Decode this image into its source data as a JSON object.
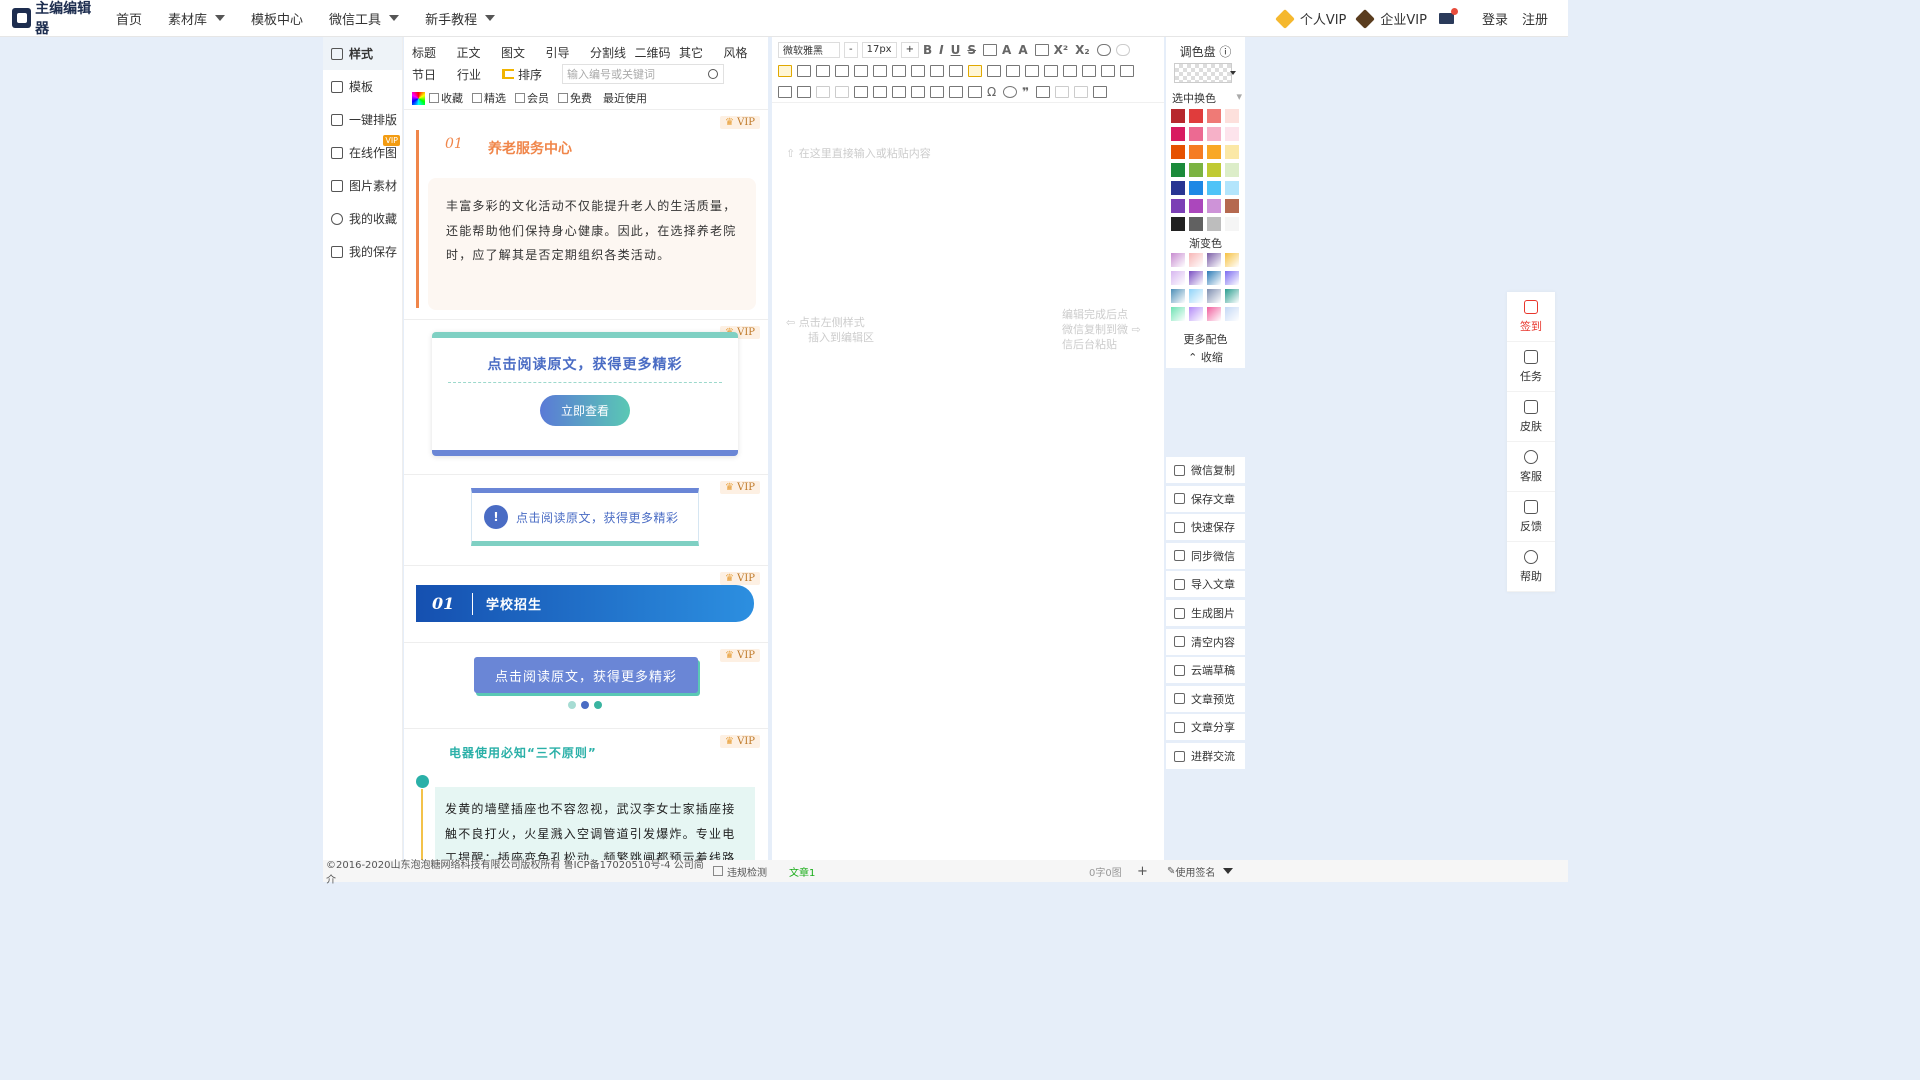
{
  "brand": {
    "name": "主编编辑器"
  },
  "nav": {
    "home": "首页",
    "materials": "素材库",
    "templates": "模板中心",
    "wechat_tools": "微信工具",
    "tutorial": "新手教程"
  },
  "top": {
    "personal_vip": "个人VIP",
    "enterprise_vip": "企业VIP",
    "login": "登录",
    "register": "注册"
  },
  "leftnav": [
    "样式",
    "模板",
    "一键排版",
    "在线作图",
    "图片素材",
    "我的收藏",
    "我的保存"
  ],
  "leftnav_vip": "VIP",
  "tabs": {
    "row1": [
      "标题",
      "正文",
      "图文",
      "引导",
      "分割线",
      "二维码",
      "其它",
      "风格"
    ],
    "row2": [
      "节日",
      "行业"
    ],
    "sort": "排序",
    "search_placeholder": "输入编号或关键词"
  },
  "filters": {
    "fav": "收藏",
    "featured": "精选",
    "member": "会员",
    "free": "免费",
    "recent": "最近使用"
  },
  "vip": "VIP",
  "cards": {
    "c1": {
      "num": "01",
      "title": "养老服务中心",
      "body": "丰富多彩的文化活动不仅能提升老人的生活质量，还能帮助他们保持身心健康。因此，在选择养老院时，应了解其是否定期组织各类活动。"
    },
    "c2": {
      "title": "点击阅读原文，获得更多精彩",
      "button": "立即查看"
    },
    "c3": {
      "icon": "!",
      "text": "点击阅读原文，获得更多精彩"
    },
    "c4": {
      "num": "01",
      "title": "学校招生"
    },
    "c5": {
      "text": "点击阅读原文，获得更多精彩"
    },
    "c6": {
      "title": "电器使用必知“三不原则”",
      "body": "发黄的墙壁插座也不容忽视，武汉李女士家插座接触不良打火，火星溅入空调管道引发爆炸。专业电工提醒：插座变色孔松动、频繁跳闸都预示着线路"
    }
  },
  "editor": {
    "font": "微软雅黑",
    "size": "17px",
    "minus": "-",
    "plus": "+",
    "hint_top": "在这里直接输入或粘贴内容",
    "hint_left_1": "点击左侧样式",
    "hint_left_2": "插入到编辑区",
    "hint_right_1": "编辑完成后点",
    "hint_right_2": "微信复制到微",
    "hint_right_3": "信后台粘贴"
  },
  "palette": {
    "title": "调色盘",
    "select_swap": "选中换色",
    "gradient": "渐变色",
    "more": "更多配色",
    "collapse": "收缩",
    "colors": [
      [
        "#b7282e",
        "#e03c3c",
        "#ef7a76",
        "#fde0dc"
      ],
      [
        "#d81b60",
        "#ec6a92",
        "#f6b1c8",
        "#fde4ec"
      ],
      [
        "#e65100",
        "#f57c22",
        "#f9a825",
        "#fbe8a6"
      ],
      [
        "#1b8a3a",
        "#7cb342",
        "#c0ca33",
        "#dcedc8"
      ],
      [
        "#283593",
        "#1e88e5",
        "#4fc3f7",
        "#b3e5fc"
      ],
      [
        "#7b3fb5",
        "#ab47bc",
        "#ce93d8",
        "#b5694f"
      ],
      [
        "#212121",
        "#616161",
        "#bdbdbd",
        "#f5f5f5"
      ]
    ],
    "gradients": [
      [
        "#c78bd0",
        "#f7b6b6",
        "#7b5ea7",
        "#f6c141"
      ],
      [
        "#d7b6f0",
        "#7a4fc2",
        "#2d7bb6",
        "#7b6cf0"
      ],
      [
        "#4d8fb7",
        "#8fd3f8",
        "#7f8fb0",
        "#2a9d8f"
      ],
      [
        "#6ee2b3",
        "#b38cf7",
        "#f0609e",
        "#c4d8f5"
      ]
    ]
  },
  "actions": [
    "微信复制",
    "保存文章",
    "快速保存",
    "同步微信",
    "导入文章",
    "生成图片",
    "清空内容",
    "云端草稿",
    "文章预览",
    "文章分享",
    "进群交流"
  ],
  "rightbar": [
    "签到",
    "任务",
    "皮肤",
    "客服",
    "反馈",
    "帮助"
  ],
  "footer": {
    "copyright": "©2016-2020山东泡泡糖网络科技有限公司版权所有 鲁ICP备17020510号-4 公司简介",
    "check": "违规检测",
    "article": "文章1",
    "count": "0字0图",
    "plus": "+",
    "sign": "使用签名"
  }
}
